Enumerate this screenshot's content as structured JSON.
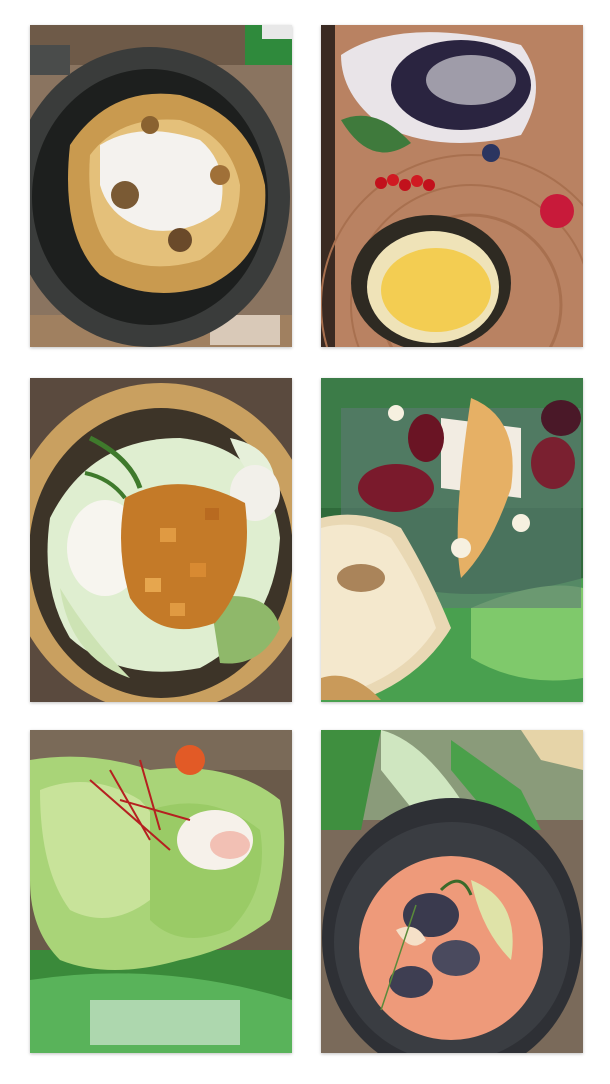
{
  "gallery": {
    "photos": [
      {
        "subject": "kaiserschmarrn-pan"
      },
      {
        "subject": "blueberry-dessert-board"
      },
      {
        "subject": "croutons-salad-bowl"
      },
      {
        "subject": "figs-toast-glass-plate"
      },
      {
        "subject": "lettuce-salad-glass-plate"
      },
      {
        "subject": "ravioli-soup-bowl"
      }
    ]
  }
}
